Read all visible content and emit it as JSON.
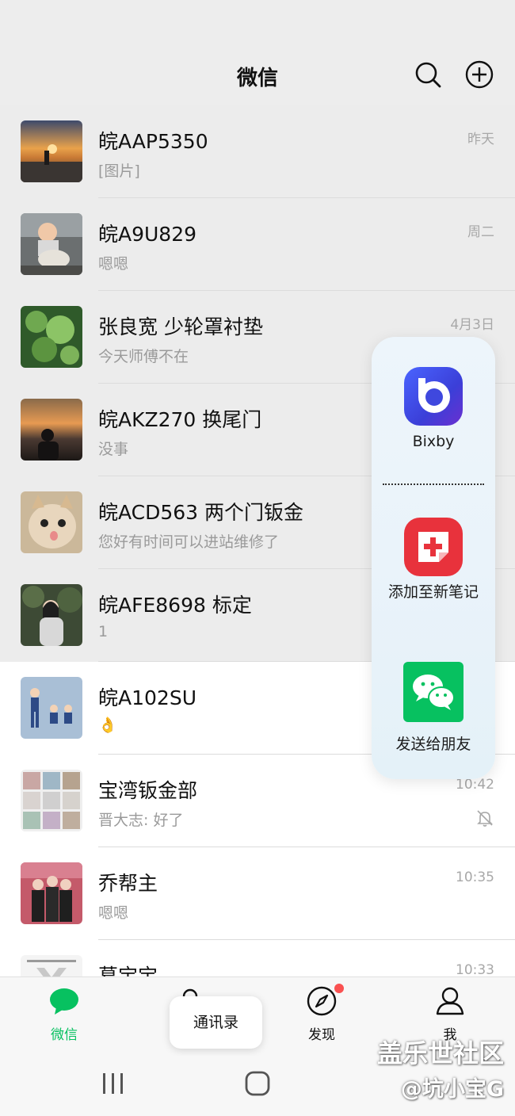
{
  "header": {
    "title": "微信"
  },
  "chats": [
    {
      "name": "皖AAP5350",
      "preview": "[图片]",
      "time": "昨天",
      "avatar": "sunset-lake-photo"
    },
    {
      "name": "皖A9U829",
      "preview": "嗯嗯",
      "time": "周二",
      "avatar": "child-on-toy-photo"
    },
    {
      "name": "张良宽 少轮罩衬垫",
      "preview": "今天师傅不在",
      "time": "4月3日",
      "avatar": "green-leaves-photo"
    },
    {
      "name": "皖AKZ270  换尾门",
      "preview": "没事",
      "time": "",
      "avatar": "sunset-silhouette-photo"
    },
    {
      "name": "皖ACD563 两个门钣金",
      "preview": "您好有时间可以进站维修了",
      "time": "",
      "avatar": "cat-photo"
    },
    {
      "name": "皖AFE8698 标定",
      "preview": "1",
      "time": "",
      "avatar": "woman-in-park-photo"
    },
    {
      "name": "皖A102SU",
      "preview": "👌",
      "time": "",
      "avatar": "cartoon-kids-illustration"
    },
    {
      "name": "宝湾钣金部",
      "preview": "晋大志: 好了",
      "time": "10:42",
      "avatar": "group-grid-avatar",
      "muted": true
    },
    {
      "name": "乔帮主",
      "preview": "嗯嗯",
      "time": "10:35",
      "avatar": "family-photo"
    },
    {
      "name": "葛宝宝",
      "preview": "",
      "time": "10:33",
      "avatar": "text-card-avatar"
    }
  ],
  "popup": {
    "items": [
      {
        "label": "Bixby",
        "icon": "bixby-icon"
      },
      {
        "label": "添加至新笔记",
        "icon": "samsung-notes-icon"
      },
      {
        "label": "发送给朋友",
        "icon": "wechat-icon"
      }
    ]
  },
  "tabs": [
    {
      "label": "微信",
      "icon": "chat-bubble-icon",
      "active": true
    },
    {
      "label": "通讯录",
      "icon": "contacts-icon"
    },
    {
      "label": "发现",
      "icon": "compass-icon",
      "badge": true
    },
    {
      "label": "我",
      "icon": "person-icon"
    }
  ],
  "tooltip": {
    "text": "通讯录"
  },
  "watermark": {
    "line1": "盖乐世社区",
    "line2": "@坑小宝G"
  },
  "colors": {
    "accent": "#07c160",
    "badge": "#fa5151",
    "background": "#ededed"
  }
}
